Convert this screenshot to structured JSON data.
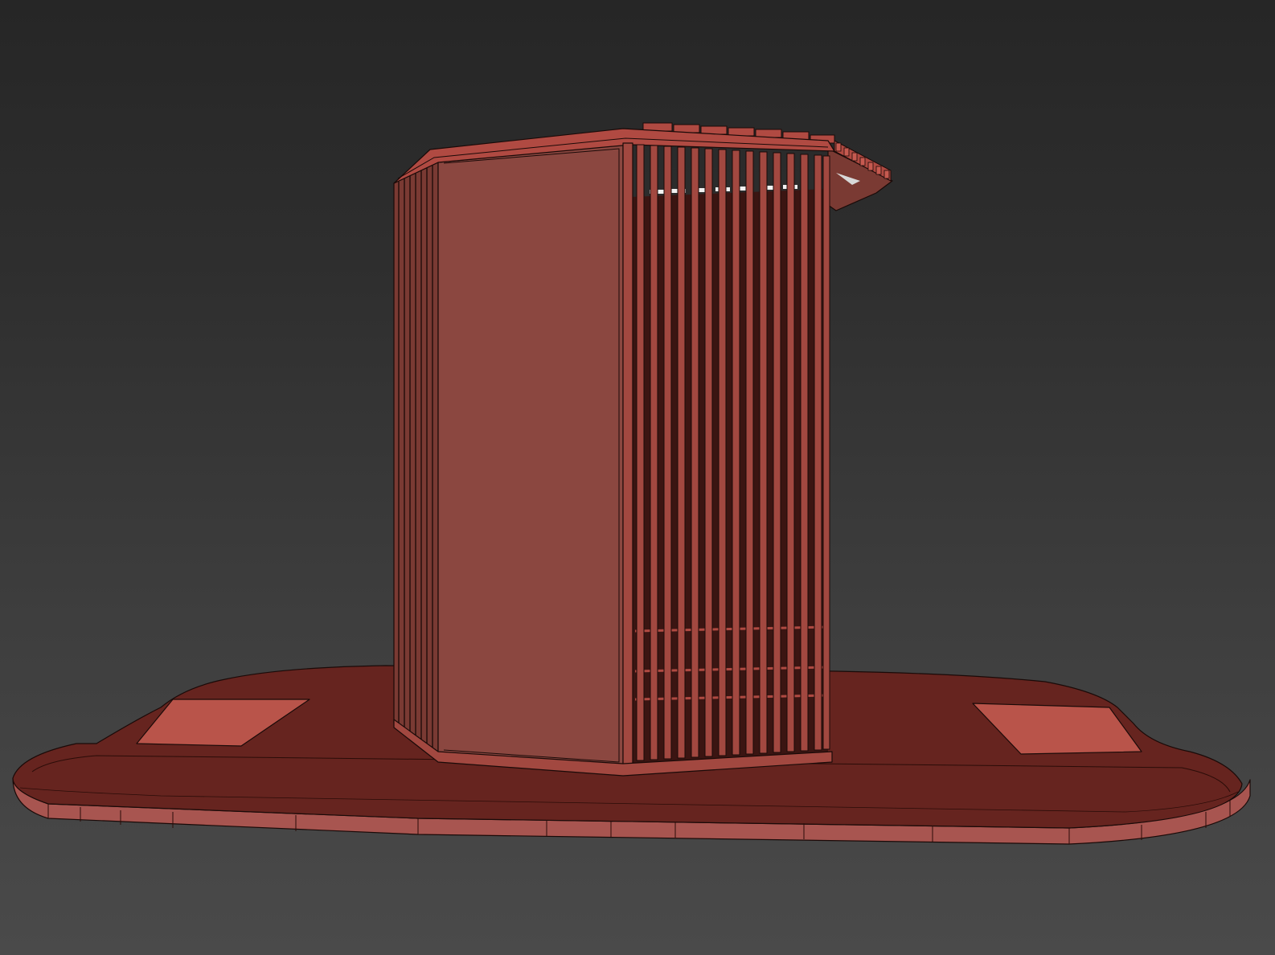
{
  "viewport": {
    "background_top": "#262626",
    "background_bottom": "#4a4a4a"
  },
  "scene": {
    "render_mode": "shaded-with-edges",
    "model_color": "#8b4740",
    "base_color": "#66241f",
    "base_edge_color": "#a85550",
    "highlight_color": "#b9544a",
    "wire_color": "#1a0a08"
  }
}
